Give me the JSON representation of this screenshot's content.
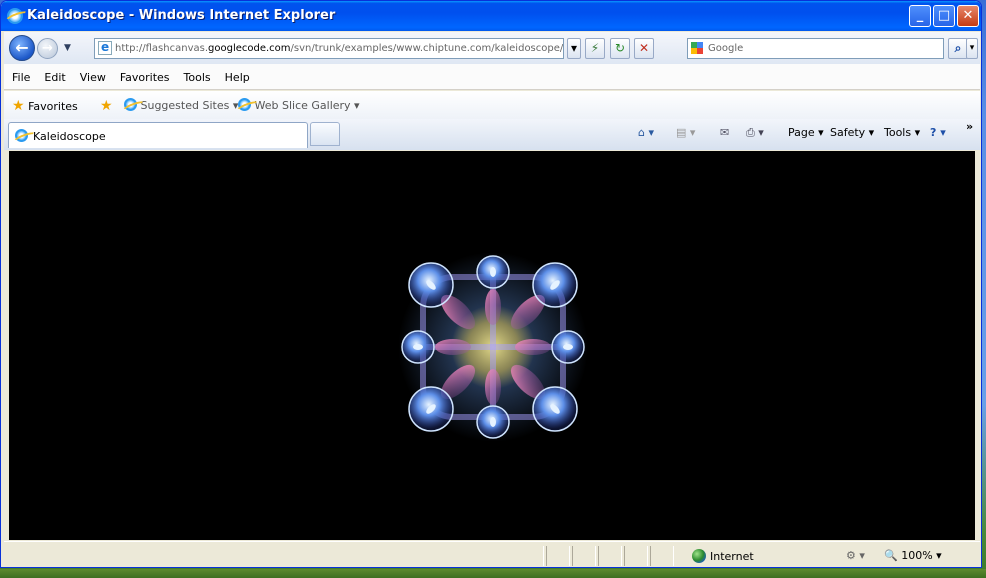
{
  "window": {
    "title": "Kaleidoscope - Windows Internet Explorer",
    "minimize_glyph": "_",
    "maximize_glyph": "□",
    "close_glyph": "✕"
  },
  "address_bar": {
    "url_prefix": "http://flashcanvas.",
    "url_domain": "googlecode.com",
    "url_suffix": "/svn/trunk/examples/www.chiptune.com/kaleidoscope/index.htm",
    "dropdown_glyph": "▾",
    "compat_glyph": "⚡",
    "refresh_glyph": "↻",
    "stop_glyph": "✕"
  },
  "search": {
    "placeholder": "Google",
    "search_glyph": "⌕",
    "options_glyph": "▾"
  },
  "nav": {
    "back_glyph": "←",
    "forward_glyph": "→",
    "history_glyph": "▼"
  },
  "menu": [
    "File",
    "Edit",
    "View",
    "Favorites",
    "Tools",
    "Help"
  ],
  "favorites_bar": {
    "favorites_label": "Favorites",
    "suggested_sites": "Suggested Sites ▾",
    "web_slice_gallery": "Web Slice Gallery ▾"
  },
  "tab": {
    "label": "Kaleidoscope"
  },
  "command_bar": {
    "home_glyph": "⌂ ▾",
    "feeds_glyph": "▤ ▾",
    "mail_glyph": "✉",
    "print_glyph": "⎙ ▾",
    "page": "Page ▾",
    "safety": "Safety ▾",
    "tools": "Tools ▾",
    "help_glyph": "? ▾",
    "chevron": "»"
  },
  "status_bar": {
    "zone": "Internet",
    "zoom": "100%",
    "zoom_dropdown": "▾"
  },
  "colors": {
    "title_blue": "#0058ee",
    "content_bg": "#000000",
    "kaleido_blue": "#6fa8ff",
    "kaleido_pink": "#ff8ec0",
    "kaleido_gold": "#c8b04a"
  }
}
